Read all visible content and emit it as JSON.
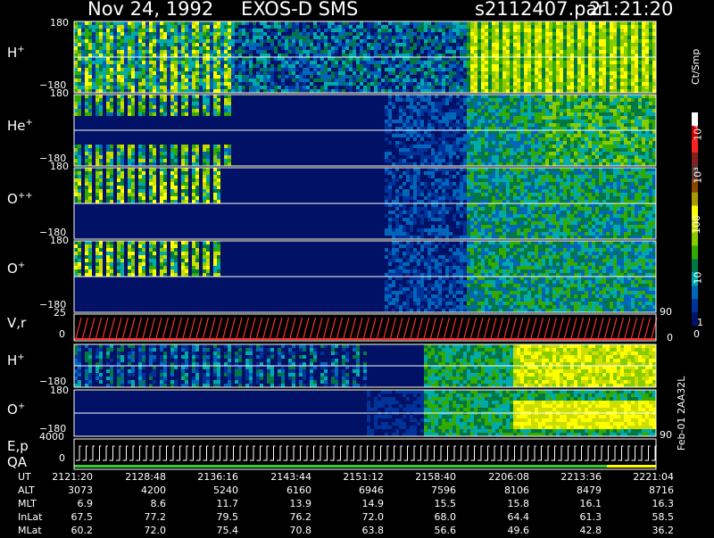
{
  "header": {
    "date": "Nov 24, 1992",
    "instrument": "EXOS-D SMS",
    "file": "s2112407.par",
    "time": "21:21:20"
  },
  "panels": [
    {
      "id": "hplus",
      "label": "H",
      "sup": "+",
      "ymax": "180",
      "ymin": "−180",
      "style": "multi"
    },
    {
      "id": "heplus",
      "label": "He",
      "sup": "+",
      "ymax": "180",
      "ymin": "−180",
      "style": "he"
    },
    {
      "id": "oplusplus",
      "label": "O",
      "sup": "++",
      "ymax": "180",
      "ymin": "−180",
      "style": "o"
    },
    {
      "id": "oplus",
      "label": "O",
      "sup": "+",
      "ymax": "180",
      "ymin": "−180",
      "style": "o"
    },
    {
      "id": "vr",
      "label": "V,r",
      "ymax": "25",
      "ymin": "0",
      "right_tick": "90",
      "right_tick_low": "0"
    },
    {
      "id": "hplus2",
      "label": "H",
      "sup": "+",
      "ymax": "",
      "ymin": "−180",
      "style": "hi"
    },
    {
      "id": "oplus2",
      "label": "O",
      "sup": "+",
      "ymax": "180",
      "ymin": "−180",
      "style": "oi"
    },
    {
      "id": "ep",
      "label": "E,p",
      "label2": "QA",
      "ymax": "4000",
      "ymin": "0",
      "right_tick": "90"
    }
  ],
  "colorbar": {
    "unit": "Ct/Smp",
    "ticks": [
      "10⁴",
      "10³",
      "100",
      "10",
      "1",
      "0"
    ],
    "colors": [
      "#ffffff",
      "#cc0000",
      "#ff2020",
      "#802020",
      "#553333",
      "#884400",
      "#aa9900",
      "#ffff00",
      "#ccdd00",
      "#88cc00",
      "#33aa00",
      "#007744",
      "#00aaaa",
      "#0066bb",
      "#003399",
      "#001166"
    ]
  },
  "ut_table": {
    "rows": [
      {
        "name": "UT",
        "values": [
          "2121:20",
          "2128:48",
          "2136:16",
          "2143:44",
          "2151:12",
          "2158:40",
          "2206:08",
          "2213:36",
          "2221:04"
        ]
      },
      {
        "name": "ALT",
        "values": [
          "3073",
          "4200",
          "5240",
          "6160",
          "6946",
          "7596",
          "8106",
          "8479",
          "8716"
        ]
      },
      {
        "name": "MLT",
        "values": [
          "6.9",
          "8.6",
          "11.7",
          "13.9",
          "14.9",
          "15.5",
          "15.8",
          "16.1",
          "16.3"
        ]
      },
      {
        "name": "InLat",
        "values": [
          "67.5",
          "77.2",
          "79.5",
          "76.2",
          "72.0",
          "68.0",
          "64.4",
          "61.3",
          "58.5"
        ]
      },
      {
        "name": "MLat",
        "values": [
          "60.2",
          "72.0",
          "75.4",
          "70.8",
          "63.8",
          "56.6",
          "49.6",
          "42.8",
          "36.2"
        ]
      }
    ]
  },
  "footer": {
    "processed": "Feb-01 2AA32L"
  }
}
